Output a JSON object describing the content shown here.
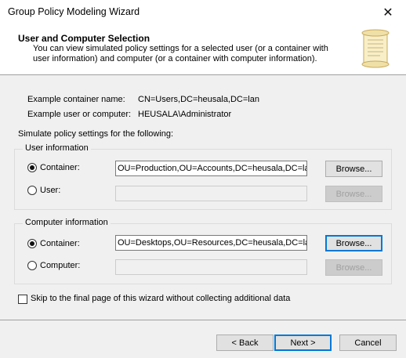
{
  "window": {
    "title": "Group Policy Modeling Wizard"
  },
  "header": {
    "title": "User and Computer Selection",
    "description": "You can view simulated policy settings for a selected user (or a container with user information) and computer (or a container with computer information)."
  },
  "examples": {
    "container_label": "Example container name:",
    "container_value": "CN=Users,DC=heusala,DC=lan",
    "user_label": "Example user or computer:",
    "user_value": "HEUSALA\\Administrator"
  },
  "simulate_label": "Simulate policy settings for the following:",
  "user_info": {
    "legend": "User information",
    "container_label": "Container:",
    "container_value": "OU=Production,OU=Accounts,DC=heusala,DC=lan",
    "user_label": "User:",
    "user_value": "",
    "browse_label": "Browse..."
  },
  "computer_info": {
    "legend": "Computer information",
    "container_label": "Container:",
    "container_value": "OU=Desktops,OU=Resources,DC=heusala,DC=lan",
    "computer_label": "Computer:",
    "computer_value": "",
    "browse_label": "Browse..."
  },
  "skip_label": "Skip to the final page of this wizard without collecting additional data",
  "footer": {
    "back": "< Back",
    "next": "Next >",
    "cancel": "Cancel"
  }
}
